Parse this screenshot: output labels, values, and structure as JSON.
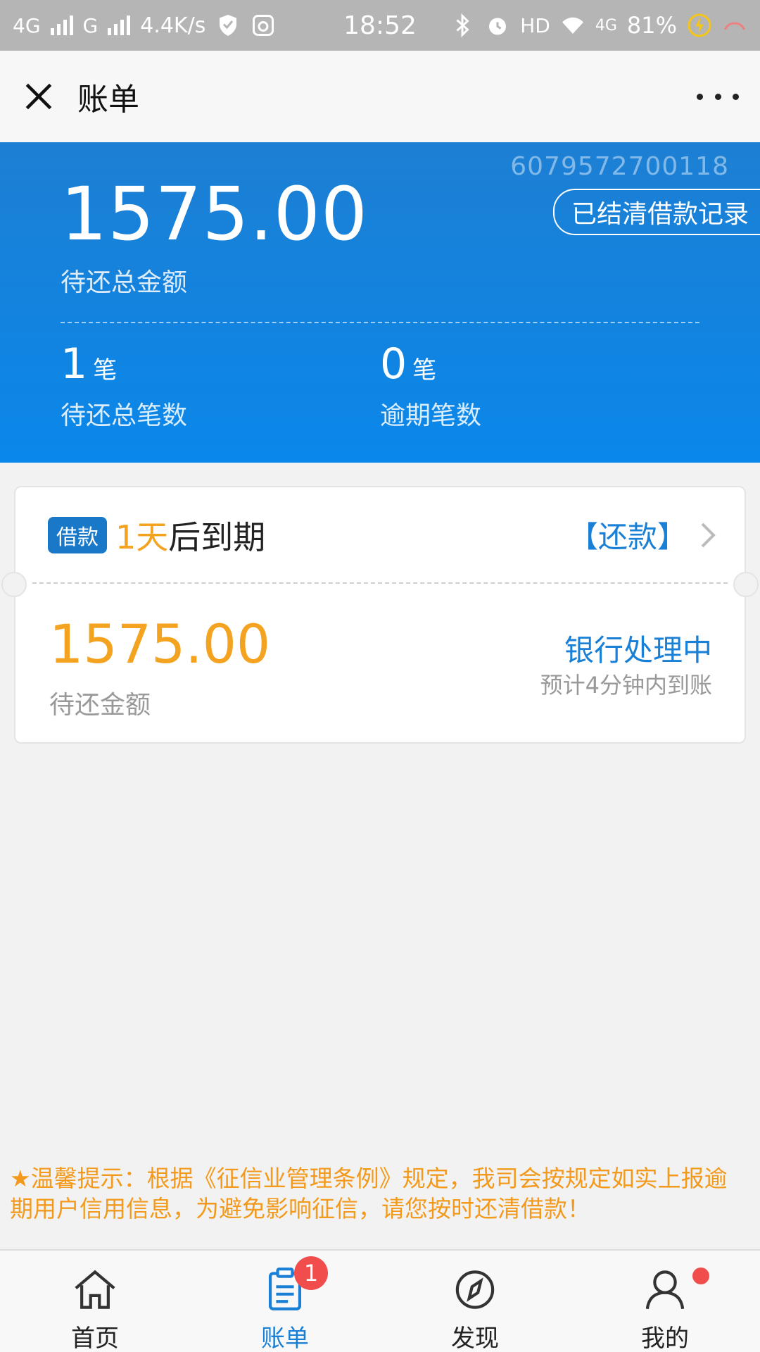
{
  "status_bar": {
    "net_left": "4G",
    "net_g": "G",
    "speed": "4.4K/s",
    "time": "18:52",
    "hd": "HD",
    "net_right": "4G",
    "battery": "81%"
  },
  "header": {
    "title": "账单"
  },
  "summary": {
    "account_number": "6079572700118",
    "settled_button": "已结清借款记录",
    "total_amount": "1575.00",
    "total_label": "待还总金额",
    "pending_count": "1",
    "pending_unit": "笔",
    "pending_label": "待还总笔数",
    "overdue_count": "0",
    "overdue_unit": "笔",
    "overdue_label": "逾期笔数"
  },
  "loan_card": {
    "tag": "借款",
    "due_number": "1天",
    "due_text": "后到期",
    "repay_link": "【还款】",
    "amount": "1575.00",
    "amount_label": "待还金额",
    "status": "银行处理中",
    "status_detail": "预计4分钟内到账"
  },
  "notice": {
    "text": "★温馨提示：根据《征信业管理条例》规定，我司会按规定如实上报逾期用户信用信息，为避免影响征信，请您按时还清借款！"
  },
  "tabbar": {
    "items": [
      {
        "label": "首页",
        "icon": "home-icon"
      },
      {
        "label": "账单",
        "icon": "bill-icon",
        "badge": "1"
      },
      {
        "label": "发现",
        "icon": "compass-icon"
      },
      {
        "label": "我的",
        "icon": "user-icon"
      }
    ]
  },
  "colors": {
    "primary_blue": "#1a80d6",
    "accent_orange": "#f3a31f",
    "badge_red": "#f24d4d"
  }
}
